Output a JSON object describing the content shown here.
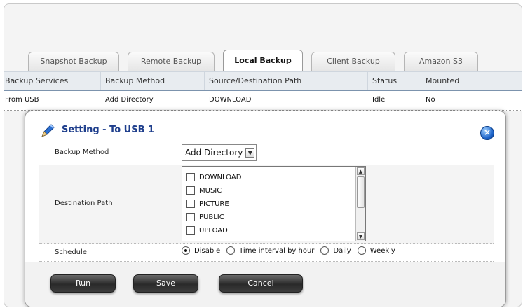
{
  "tabs": [
    {
      "label": "Snapshot Backup",
      "active": false
    },
    {
      "label": "Remote Backup",
      "active": false
    },
    {
      "label": "Local Backup",
      "active": true
    },
    {
      "label": "Client Backup",
      "active": false
    },
    {
      "label": "Amazon S3",
      "active": false
    }
  ],
  "table": {
    "columns": [
      "Backup Services",
      "Backup Method",
      "Source/Destination Path",
      "Status",
      "Mounted"
    ],
    "rows": [
      [
        "From USB",
        "Add Directory",
        "DOWNLOAD",
        "Idle",
        "No"
      ]
    ]
  },
  "modal": {
    "title": "Setting - To USB 1",
    "close_icon": "close-icon",
    "backup_method": {
      "label": "Backup Method",
      "selected": "Add Directory"
    },
    "destination": {
      "label": "Destination Path",
      "items": [
        "DOWNLOAD",
        "MUSIC",
        "PICTURE",
        "PUBLIC",
        "UPLOAD"
      ]
    },
    "schedule": {
      "label": "Schedule",
      "options": [
        "Disable",
        "Time interval by hour",
        "Daily",
        "Weekly"
      ],
      "selected": "Disable"
    },
    "buttons": {
      "run": "Run",
      "save": "Save",
      "cancel": "Cancel"
    }
  },
  "colors": {
    "title_blue": "#1e3e8c",
    "header_underline": "#7c93ad",
    "button_dark": "#2a2a2a"
  }
}
